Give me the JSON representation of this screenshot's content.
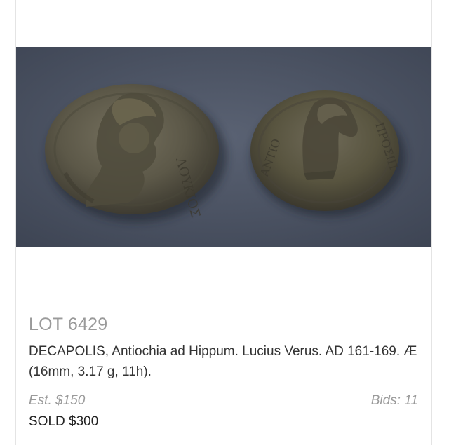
{
  "lot": {
    "title": "LOT 6429",
    "description": "DECAPOLIS, Antiochia ad Hippum. Lucius Verus. AD 161-169. Æ (16mm, 3.17 g, 11h).",
    "estimate": "Est. $150",
    "bids": "Bids: 11",
    "sold": "SOLD $300"
  },
  "photo": {
    "subject": "coin-obverse-and-reverse",
    "background_color": "#4a5261",
    "coin_color": "#5e5a4a"
  }
}
